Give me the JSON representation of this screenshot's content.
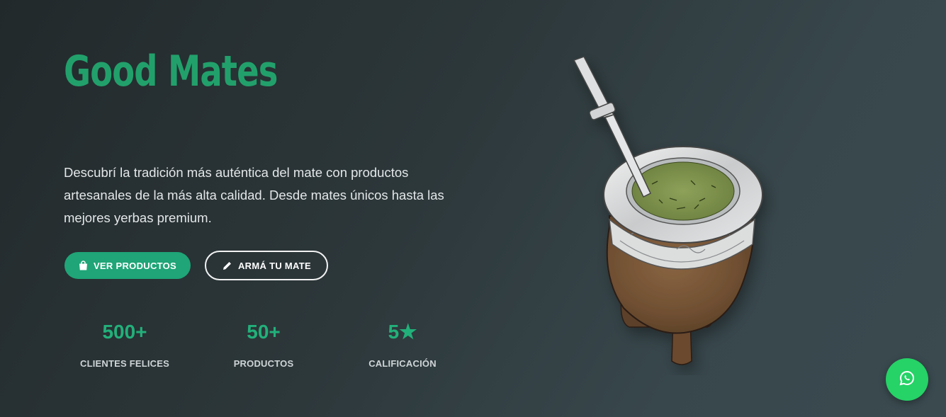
{
  "hero": {
    "brand": "Good Mates",
    "description": "Descubrí la tradición más auténtica del mate con productos artesanales de la más alta calidad. Desde mates únicos hasta las mejores yerbas premium.",
    "primary_button": {
      "label": "VER PRODUCTOS",
      "icon": "shopping-bag-icon"
    },
    "secondary_button": {
      "label": "ARMÁ TU MATE",
      "icon": "pencil-icon"
    },
    "stats": [
      {
        "value": "500+",
        "label": "CLIENTES FELICES"
      },
      {
        "value": "50+",
        "label": "PRODUCTOS"
      },
      {
        "value": "5★",
        "label": "CALIFICACIÓN"
      }
    ]
  },
  "floating": {
    "icon": "whatsapp-icon"
  },
  "colors": {
    "accent": "#22a06b",
    "primary_button": "#1fa577",
    "whatsapp": "#25d366",
    "background": "#2d383b"
  }
}
